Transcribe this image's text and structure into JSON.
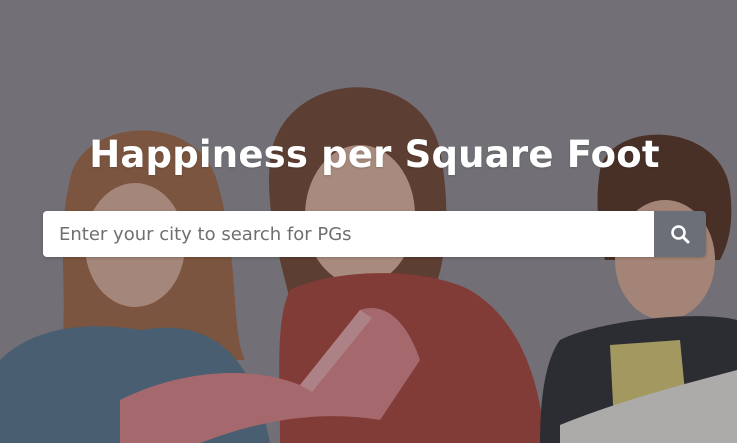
{
  "hero": {
    "headline": "Happiness per Square Foot",
    "background_image": "students-reading-books-photo"
  },
  "search": {
    "placeholder": "Enter your city to search for PGs",
    "value": "",
    "button_icon": "search-icon"
  },
  "colors": {
    "overlay": "#5a585d",
    "headline_text": "#ffffff",
    "input_background": "#ffffff",
    "search_button": "#6b7078"
  }
}
